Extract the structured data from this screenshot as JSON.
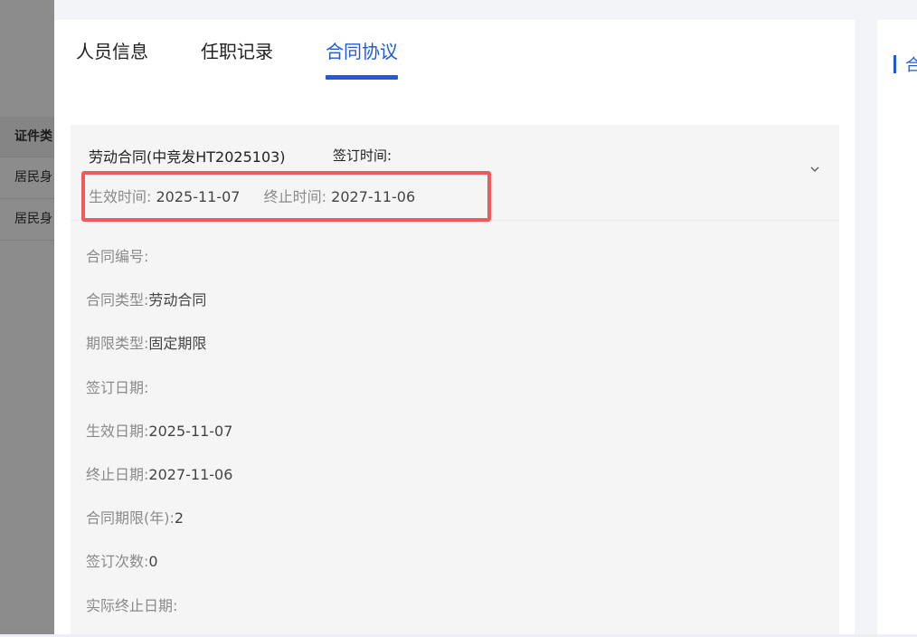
{
  "background": {
    "table": {
      "header": "证件类",
      "rows": [
        "居民身",
        "居民身"
      ]
    }
  },
  "drawer": {
    "tabs": [
      {
        "label": "人员信息",
        "active": false
      },
      {
        "label": "任职记录",
        "active": false
      },
      {
        "label": "合同协议",
        "active": true
      }
    ],
    "right_panel_title": "合",
    "contract": {
      "title": "劳动合同(中竞发HT2025103)",
      "sign_label": "签订时间:",
      "effective_label": "生效时间:",
      "effective_value": "2025-11-07",
      "end_label": "终止时间:",
      "end_value": "2027-11-06",
      "expand_icon": "chevron-down-icon",
      "fields": [
        {
          "label": "合同编号:",
          "value": ""
        },
        {
          "label": "合同类型:",
          "value": "劳动合同"
        },
        {
          "label": "期限类型:",
          "value": "固定期限"
        },
        {
          "label": "签订日期:",
          "value": ""
        },
        {
          "label": "生效日期:",
          "value": "2025-11-07"
        },
        {
          "label": "终止日期:",
          "value": "2027-11-06"
        },
        {
          "label": "合同期限(年):",
          "value": "2"
        },
        {
          "label": "签订次数:",
          "value": "0"
        },
        {
          "label": "实际终止日期:",
          "value": ""
        }
      ]
    }
  },
  "colors": {
    "accent": "#1f5bd9",
    "highlight_border": "#f05a5a"
  }
}
